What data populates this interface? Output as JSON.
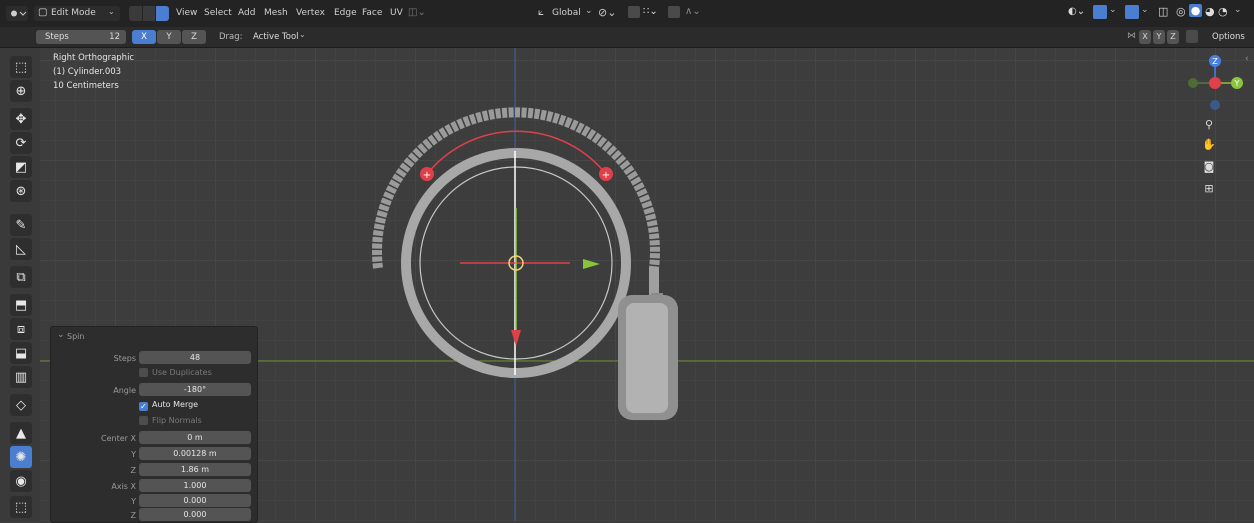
{
  "header": {
    "mode_label": "Edit Mode",
    "menu": [
      "View",
      "Select",
      "Add",
      "Mesh",
      "Vertex",
      "Edge",
      "Face",
      "UV"
    ],
    "orientation": "Global",
    "options_label": "Options"
  },
  "tool_settings": {
    "steps_label": "Steps",
    "steps_value": "12",
    "axis_x": "X",
    "axis_y": "Y",
    "axis_z": "Z",
    "drag_label": "Drag:",
    "drag_value": "Active Tool",
    "mirror_x": "X",
    "mirror_y": "Y",
    "mirror_z": "Z"
  },
  "viewport": {
    "view_name": "Right Orthographic",
    "object_name": "(1) Cylinder.003",
    "scale": "10 Centimeters"
  },
  "gizmo": {
    "z": "Z",
    "y": "Y"
  },
  "spin_panel": {
    "title": "Spin",
    "steps_label": "Steps",
    "steps": "48",
    "use_duplicates": "Use Duplicates",
    "angle_label": "Angle",
    "angle": "-180°",
    "auto_merge": "Auto Merge",
    "flip_normals": "Flip Normals",
    "center_x_label": "Center X",
    "center_x": "0 m",
    "y_label": "Y",
    "center_y": "0.00128 m",
    "z_label": "Z",
    "center_z": "1.86 m",
    "axis_x_label": "Axis X",
    "axis_x": "1.000",
    "axis_y": "0.000",
    "axis_z": "0.000"
  },
  "colors": {
    "accent": "#4b7ed0",
    "axis_x": "#e0404a",
    "axis_y": "#8ac43b",
    "axis_z": "#4a7fe0"
  }
}
